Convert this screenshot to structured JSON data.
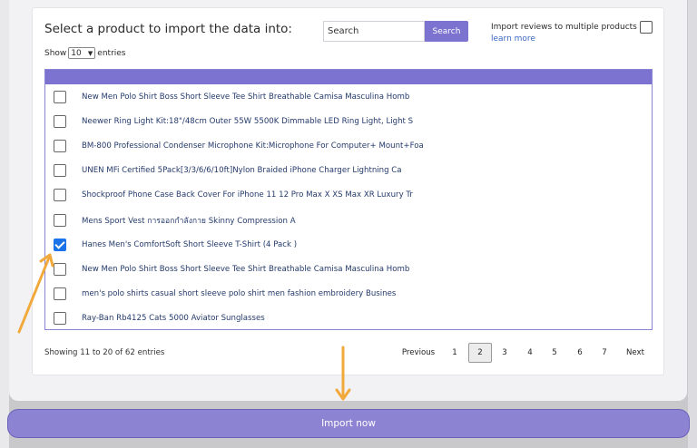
{
  "dialog": {
    "heading": "Select a product to import the data into:",
    "search_placeholder": "Search",
    "search_button": "Search",
    "reviews_label": "Import reviews to multiple products",
    "learn_more": "learn more"
  },
  "length_control": {
    "show_label": "Show",
    "value": "10",
    "entries_label": "entries"
  },
  "products": [
    {
      "name": "New Men Polo Shirt Boss Short Sleeve Tee Shirt Breathable Camisa Masculina Homb",
      "checked": false
    },
    {
      "name": "Neewer Ring Light Kit:18\"/48cm Outer 55W 5500K Dimmable LED Ring Light, Light S",
      "checked": false
    },
    {
      "name": "BM-800 Professional Condenser Microphone Kit:Microphone For Computer+ Mount+Foa",
      "checked": false
    },
    {
      "name": "UNEN MFi Certified 5Pack[3/3/6/6/10ft]Nylon Braided iPhone Charger Lightning Ca",
      "checked": false
    },
    {
      "name": "Shockproof Phone Case Back Cover For iPhone 11 12 Pro Max X XS Max XR Luxury Tr",
      "checked": false
    },
    {
      "name": "Mens Sport Vest การออกกำลังกาย Skinny Compression A",
      "checked": false
    },
    {
      "name": "Hanes Men's ComfortSoft Short Sleeve T-Shirt (4 Pack )",
      "checked": true
    },
    {
      "name": "New Men Polo Shirt Boss Short Sleeve Tee Shirt Breathable Camisa Masculina Homb",
      "checked": false
    },
    {
      "name": "men's polo shirts casual short sleeve polo shirt men fashion embroidery Busines",
      "checked": false
    },
    {
      "name": "Ray-Ban Rb4125 Cats 5000 Aviator Sunglasses",
      "checked": false
    }
  ],
  "footer": {
    "showing": "Showing 11 to 20 of 62 entries",
    "previous": "Previous",
    "pages": [
      "1",
      "2",
      "3",
      "4",
      "5",
      "6",
      "7"
    ],
    "current_page": "2",
    "next": "Next"
  },
  "import_button": "Import now",
  "colors": {
    "accent": "#7b73cf",
    "arrow": "#f2a93b",
    "checkbox_checked": "#1a73e8"
  }
}
